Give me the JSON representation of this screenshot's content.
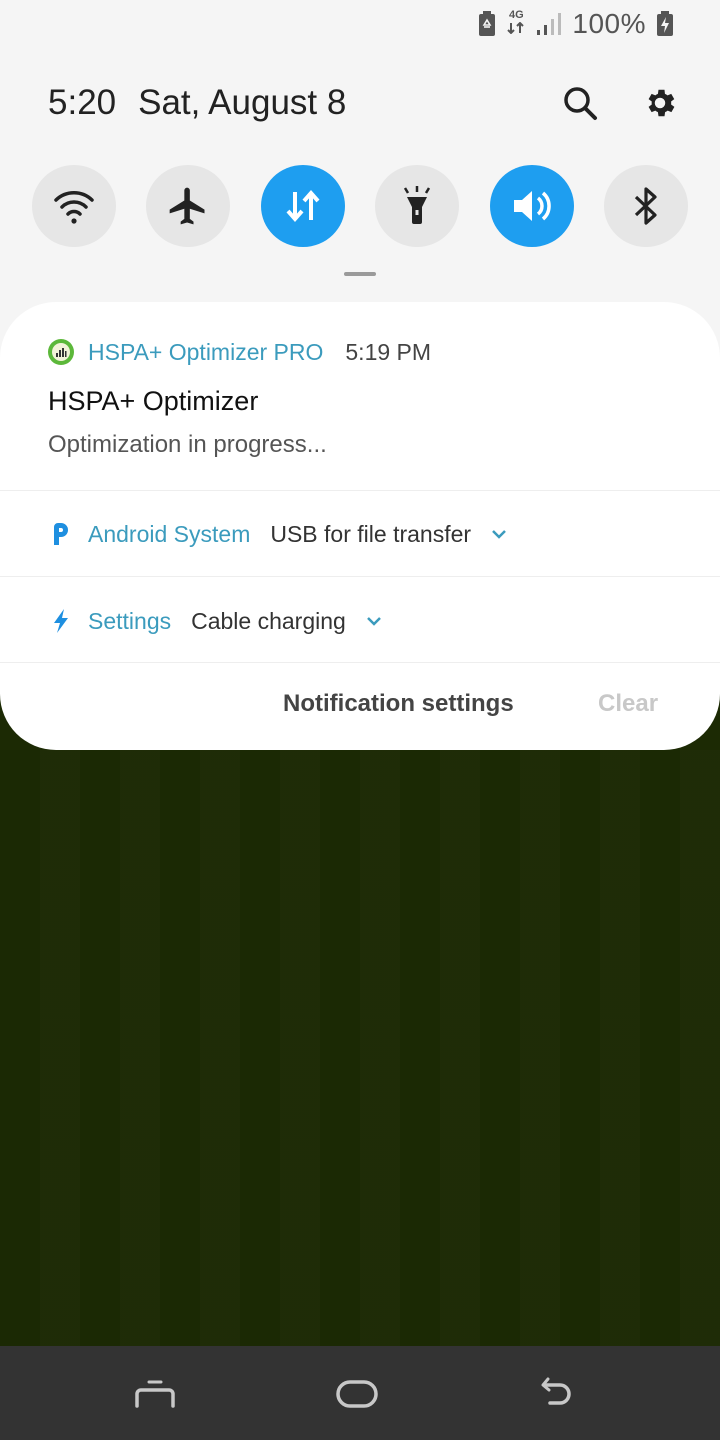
{
  "status_bar": {
    "icons": [
      "battery-saver-icon",
      "network-4g-icon",
      "signal-icon",
      "charging-battery-icon"
    ],
    "network_type": "4G",
    "battery_percent": "100%"
  },
  "header": {
    "time": "5:20",
    "date": "Sat, August 8",
    "actions": [
      "search-icon",
      "gear-icon"
    ]
  },
  "quick_settings": [
    {
      "name": "wifi",
      "icon": "wifi-icon",
      "active": false
    },
    {
      "name": "airplane-mode",
      "icon": "airplane-icon",
      "active": false
    },
    {
      "name": "mobile-data",
      "icon": "data-transfer-icon",
      "active": true
    },
    {
      "name": "flashlight",
      "icon": "flashlight-icon",
      "active": false
    },
    {
      "name": "sound",
      "icon": "volume-icon",
      "active": true
    },
    {
      "name": "bluetooth",
      "icon": "bluetooth-icon",
      "active": false
    }
  ],
  "colors": {
    "accent": "#1e9ef0",
    "app_name": "#3b9bbd",
    "wallpaper": "#1c2a04",
    "navbar": "#333333"
  },
  "notifications": {
    "main": {
      "app_name": "HSPA+ Optimizer PRO",
      "time": "5:19 PM",
      "title": "HSPA+ Optimizer",
      "text": "Optimization in progress..."
    },
    "collapsed": [
      {
        "app_name": "Android System",
        "text": "USB for file transfer",
        "icon": "android-system-p-icon"
      },
      {
        "app_name": "Settings",
        "text": "Cable charging",
        "icon": "lightning-icon"
      }
    ],
    "footer": {
      "notification_settings": "Notification settings",
      "clear": "Clear"
    }
  },
  "navbar": {
    "buttons": [
      "recents-icon",
      "home-icon",
      "back-icon"
    ]
  }
}
